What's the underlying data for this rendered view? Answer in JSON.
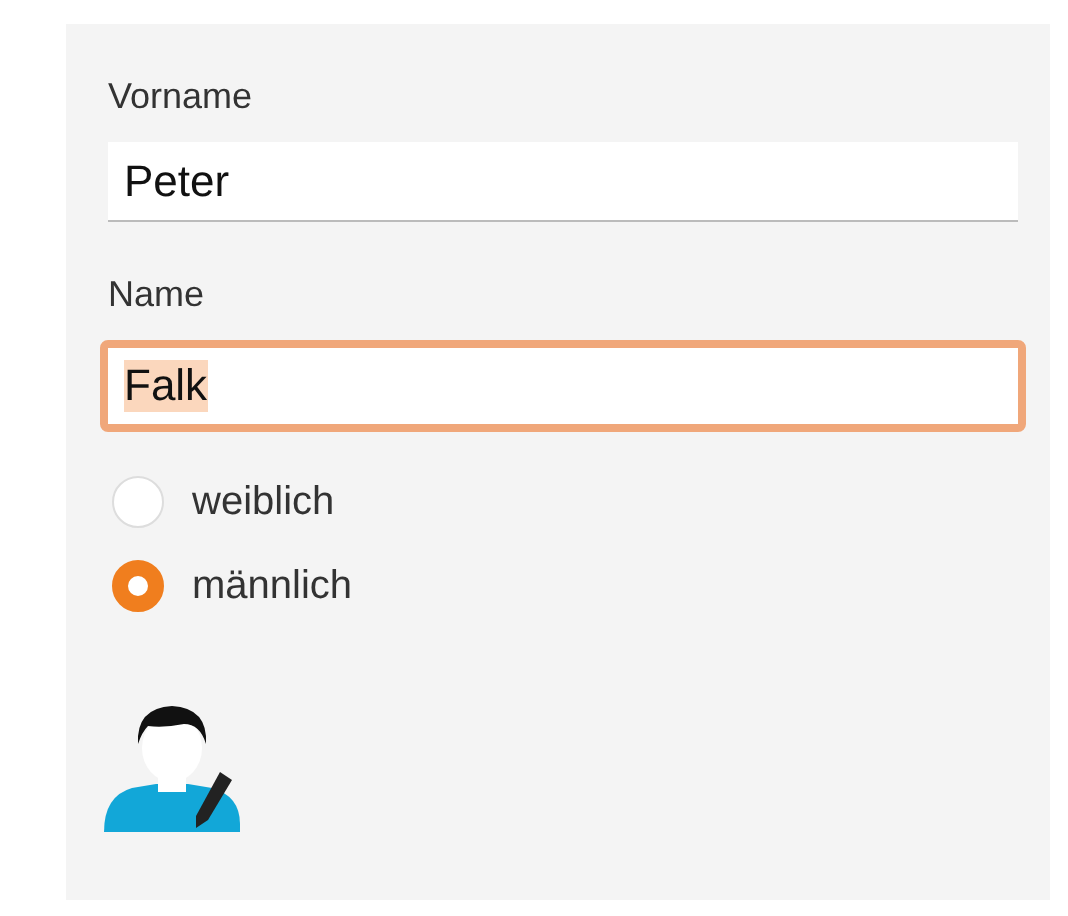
{
  "fields": [
    {
      "label": "Vorname",
      "value": "Peter",
      "focused": false
    },
    {
      "label": "Name",
      "value": "Falk",
      "focused": true
    }
  ],
  "gender_options": [
    {
      "label": "weiblich",
      "selected": false
    },
    {
      "label": "männlich",
      "selected": true
    }
  ]
}
